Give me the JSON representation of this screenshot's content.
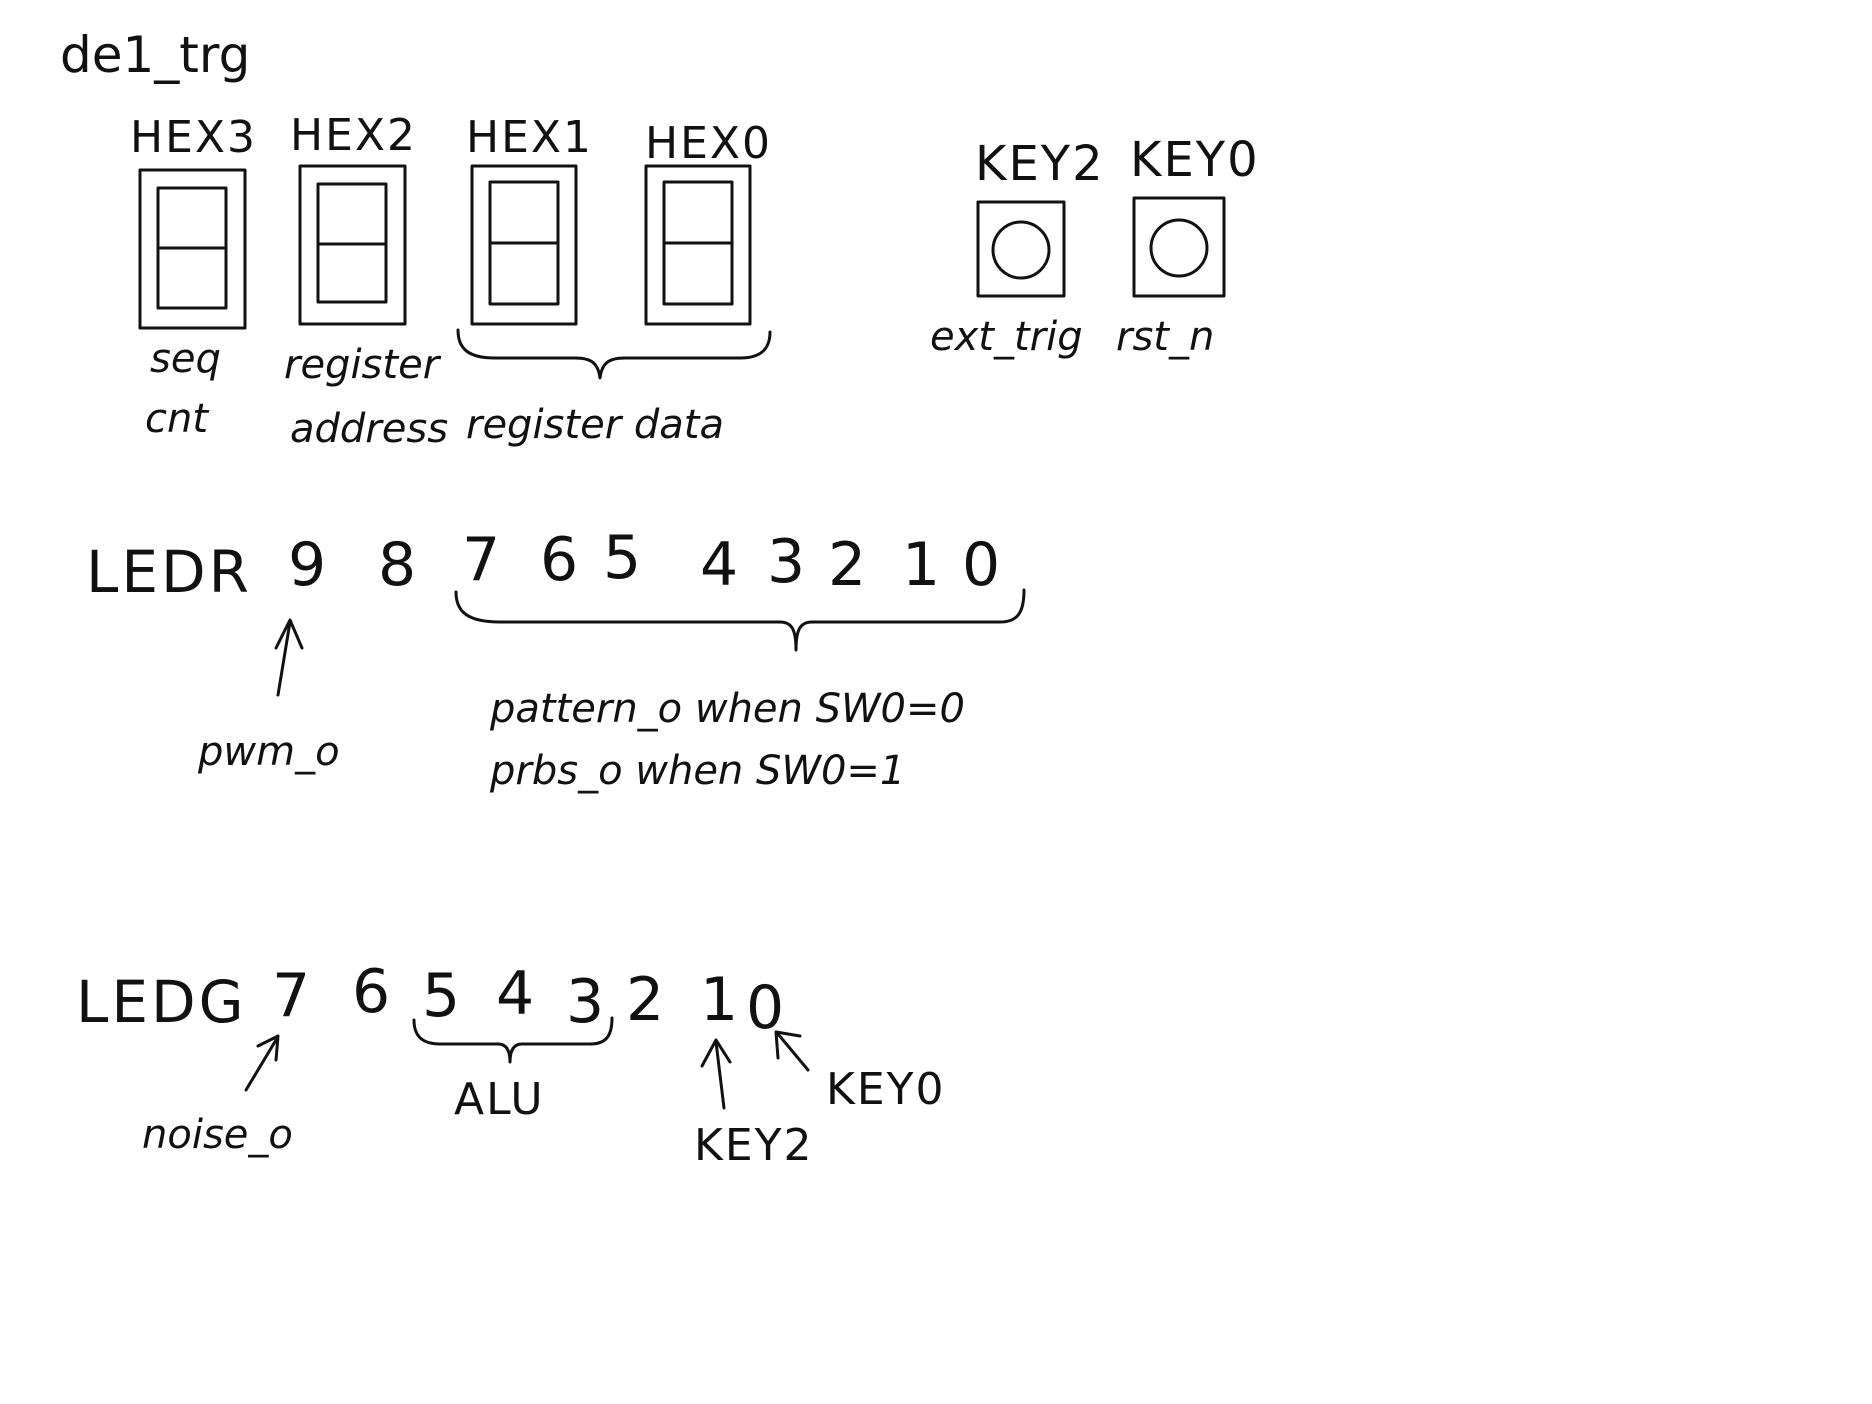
{
  "title": "de1_trg",
  "hex_displays": [
    {
      "name": "HEX3",
      "label_lines": [
        "seq",
        "cnt"
      ]
    },
    {
      "name": "HEX2",
      "label_lines": [
        "register",
        "address"
      ]
    },
    {
      "name": "HEX1"
    },
    {
      "name": "HEX0"
    }
  ],
  "hex_group_label": "register data",
  "keys": [
    {
      "name": "KEY2",
      "label": "ext_trig"
    },
    {
      "name": "KEY0",
      "label": "rst_n"
    }
  ],
  "ledr": {
    "label": "LEDR",
    "indices": [
      "9",
      "8",
      "7",
      "6",
      "5",
      "4",
      "3",
      "2",
      "1",
      "0"
    ],
    "led9_label": "pwm_o",
    "group_lines": [
      "pattern_o when SW0=0",
      "prbs_o when SW0=1"
    ]
  },
  "ledg": {
    "label": "LEDG",
    "indices": [
      "7",
      "6",
      "5",
      "4",
      "3",
      "2",
      "1",
      "0"
    ],
    "led7_label": "noise_o",
    "group_label": "ALU",
    "led1_label": "KEY2",
    "led0_label": "KEY0"
  }
}
